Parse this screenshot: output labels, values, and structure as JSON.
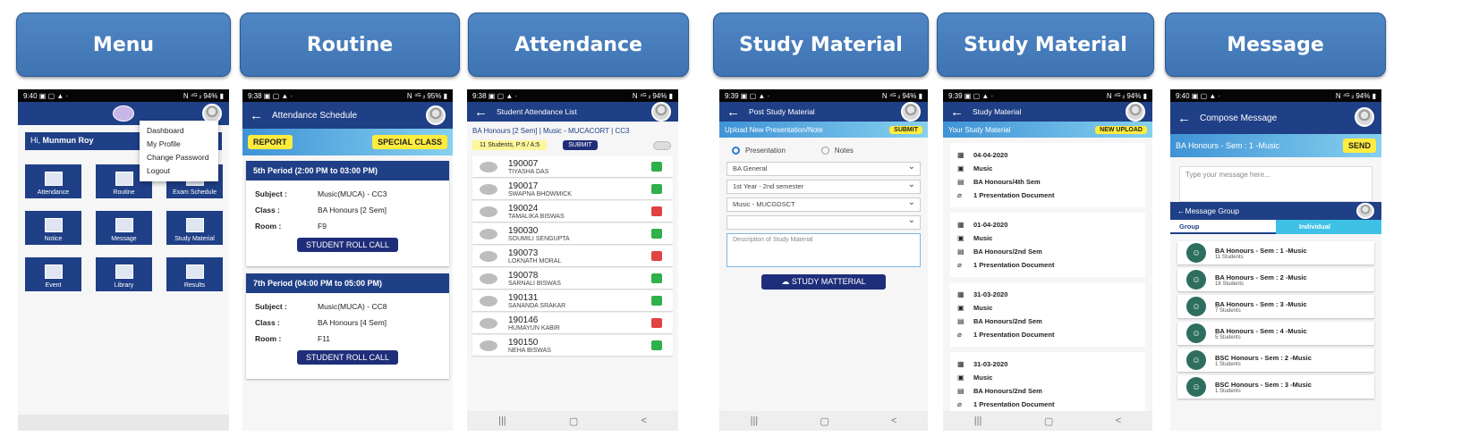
{
  "headers": [
    "Menu",
    "Routine",
    "Attendance",
    "Study Material",
    "Study Material",
    "Message"
  ],
  "status": {
    "s1": "9:40 ▣ ▢ ▲ ·",
    "s1r": "Ν ⁴ᴳ ᵢₗ 94% ▮",
    "s2": "9:38 ▣ ▢ ▲ ·",
    "s2r": "Ν ⁴ᴳ ᵢₗ 95% ▮",
    "s3": "9:38 ▣ ▢ ▲ ·",
    "s3r": "Ν ⁴ᴳ ᵢₗ 94% ▮",
    "s4": "9:39 ▣ ▢ ▲ ·",
    "s4r": "Ν ⁴ᴳ ᵢₗ 94% ▮",
    "s5": "9:39 ▣ ▢ ▲ ·",
    "s5r": "Ν ⁴ᴳ ᵢₗ 94% ▮",
    "s6": "9:40 ▣ ▢ ▲ ·",
    "s6r": "Ν ⁴ᴳ ᵢₗ 94% ▮"
  },
  "menu": {
    "greet": "Hi, ",
    "user": "Munmun Roy",
    "dropdown": [
      "Dashboard",
      "My Profile",
      "Change Password",
      "Logout"
    ],
    "tiles": [
      "Attendance",
      "Routine",
      "Exam Schedule",
      "Notice",
      "Message",
      "Study Material",
      "Event",
      "Library",
      "Results"
    ]
  },
  "routine": {
    "title": "Attendance Schedule",
    "report": "REPORT",
    "special": "SPECIAL CLASS",
    "cards": [
      {
        "head": "5th Period (2:00 PM to 03:00 PM)",
        "subject": "Music(MUCA) - CC3",
        "class": "BA Honours [2 Sem]",
        "room": "F9"
      },
      {
        "head": "7th Period (04:00 PM to 05:00 PM)",
        "subject": "Music(MUCA) - CC8",
        "class": "BA Honours [4 Sem]",
        "room": "F11"
      }
    ],
    "l_subject": "Subject :",
    "l_class": "Class :",
    "l_room": "Room :",
    "rollcall": "STUDENT ROLL CALL"
  },
  "attendance": {
    "title": "Student Attendance List",
    "course": "BA Honours [2 Sem] | Music - MUCACORT | CC3",
    "count": "11 Students, P:6 / A:5",
    "submit": "SUBMIT",
    "students": [
      {
        "id": "190007",
        "name": "TIYASHA DAS",
        "p": true
      },
      {
        "id": "190017",
        "name": "SWAPNA BHOWMICK",
        "p": true
      },
      {
        "id": "190024",
        "name": "TAMALIKA BISWAS",
        "p": false
      },
      {
        "id": "190030",
        "name": "SOUMILI SENGUPTA",
        "p": true
      },
      {
        "id": "190073",
        "name": "LOKNATH MORAL",
        "p": false
      },
      {
        "id": "190078",
        "name": "SARNALI BISWAS",
        "p": true
      },
      {
        "id": "190131",
        "name": "SANANDA SRAKAR",
        "p": true
      },
      {
        "id": "190146",
        "name": "HUMAYUN KABIR",
        "p": false
      },
      {
        "id": "190150",
        "name": "NEHA BISWAS",
        "p": true
      }
    ]
  },
  "post": {
    "title": "Post Study Material",
    "sub": "Upload New Presentation/Note",
    "submit": "SUBMIT",
    "opt1": "Presentation",
    "opt2": "Notes",
    "selects": [
      "BA General",
      "1st Year - 2nd semester",
      "Music - MUCGDSCT",
      ""
    ],
    "desc": "Description of Study Material",
    "btn": "STUDY MATTERIAL"
  },
  "study": {
    "title": "Study Material",
    "sub": "Your Study Material",
    "upload": "NEW UPLOAD",
    "items": [
      {
        "date": "04-04-2020",
        "subj": "Music",
        "cls": "BA Honours/4th Sem",
        "doc": "1 Presentation Document"
      },
      {
        "date": "01-04-2020",
        "subj": "Music",
        "cls": "BA Honours/2nd Sem",
        "doc": "1 Presentation Document"
      },
      {
        "date": "31-03-2020",
        "subj": "Music",
        "cls": "BA Honours/2nd Sem",
        "doc": "1 Presentation Document"
      },
      {
        "date": "31-03-2020",
        "subj": "Music",
        "cls": "BA Honours/2nd Sem",
        "doc": "1 Presentation Document"
      }
    ]
  },
  "message": {
    "title": "Compose Message",
    "to": "BA Honours - Sem : 1 -Music",
    "send": "SEND",
    "placeholder": "Type your message here...",
    "group_title": "Message Group",
    "tab1": "Group",
    "tab2": "Individual",
    "groups": [
      {
        "n": "BA Honours - Sem : 1 -Music",
        "s": "11 Students"
      },
      {
        "n": "BA Honours - Sem : 2 -Music",
        "s": "18 Students"
      },
      {
        "n": "BA Honours - Sem : 3 -Music",
        "s": "7 Students"
      },
      {
        "n": "BA Honours - Sem : 4 -Music",
        "s": "5 Students"
      },
      {
        "n": "BSC Honours - Sem : 2 -Music",
        "s": "1 Students"
      },
      {
        "n": "BSC Honours - Sem : 3 -Music",
        "s": "1 Students"
      }
    ]
  },
  "nav": {
    "a": "|||",
    "b": "▢",
    "c": "<"
  }
}
